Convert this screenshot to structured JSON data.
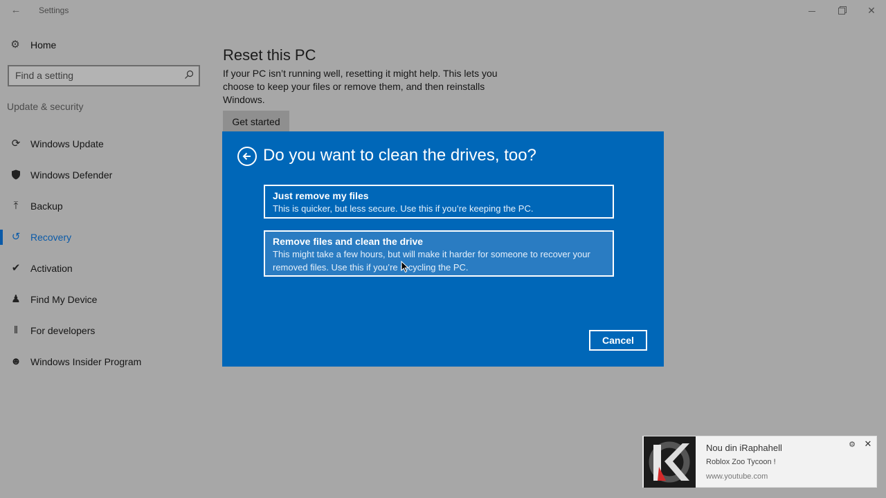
{
  "window": {
    "title": "Settings",
    "back_icon": "back-arrow-icon",
    "controls": {
      "minimize": "minimize-icon",
      "restore": "restore-icon",
      "close": "close-icon"
    }
  },
  "sidebar": {
    "home_label": "Home",
    "search_placeholder": "Find a setting",
    "section_label": "Update & security",
    "items": [
      {
        "label": "Windows Update",
        "icon": "refresh-icon",
        "active": false
      },
      {
        "label": "Windows Defender",
        "icon": "shield-icon",
        "active": false
      },
      {
        "label": "Backup",
        "icon": "upload-arrow-icon",
        "active": false
      },
      {
        "label": "Recovery",
        "icon": "history-icon",
        "active": true
      },
      {
        "label": "Activation",
        "icon": "check-circle-icon",
        "active": false
      },
      {
        "label": "Find My Device",
        "icon": "person-pin-icon",
        "active": false
      },
      {
        "label": "For developers",
        "icon": "developer-tools-icon",
        "active": false
      },
      {
        "label": "Windows Insider Program",
        "icon": "person-insider-icon",
        "active": false
      }
    ]
  },
  "main": {
    "title": "Reset this PC",
    "description": "If your PC isn’t running well, resetting it might help. This lets you choose to keep your files or remove them, and then reinstalls Windows.",
    "button_label": "Get started"
  },
  "dialog": {
    "title": "Do you want to clean the drives, too?",
    "options": [
      {
        "title": "Just remove my files",
        "text": "This is quicker, but less secure. Use this if you’re keeping the PC."
      },
      {
        "title": "Remove files and clean the drive",
        "text": "This might take a few hours, but will make it harder for someone to recover your removed files. Use this if you’re recycling the PC."
      }
    ],
    "cancel_label": "Cancel"
  },
  "notification": {
    "title": "Nou din iRaphahell",
    "body": "Roblox Zoo Tycoon !",
    "url": "www.youtube.com"
  },
  "colors": {
    "dialog_bg": "#0067b8",
    "accent": "#0a5aa8",
    "background": "#a7a7a7"
  }
}
